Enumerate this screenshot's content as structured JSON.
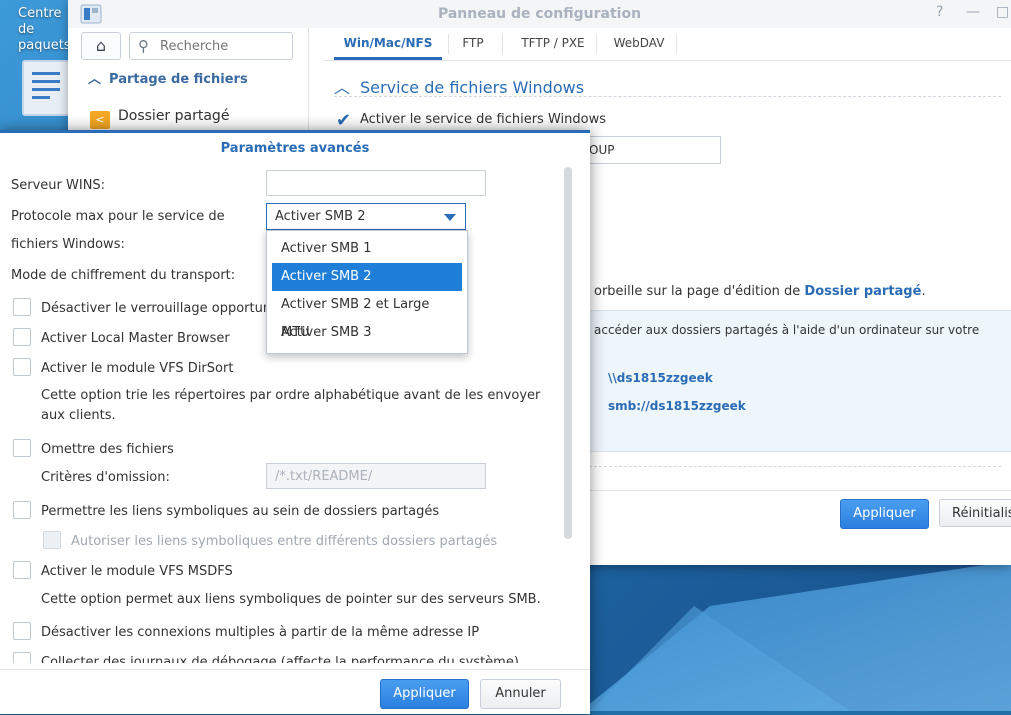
{
  "desktop": {
    "label": "Centre de paquets"
  },
  "control_panel": {
    "title": "Panneau de configuration",
    "controls": {
      "help": "?",
      "minimize": "—",
      "maximize": "□"
    },
    "search_placeholder": "Recherche",
    "sidebar": {
      "section": "Partage de fichiers",
      "items": [
        {
          "label": "Dossier partagé"
        }
      ]
    },
    "tabs": [
      {
        "label": "Win/Mac/NFS",
        "active": true
      },
      {
        "label": "FTP",
        "active": false
      },
      {
        "label": "TFTP / PXE",
        "active": false
      },
      {
        "label": "WebDAV",
        "active": false
      }
    ],
    "section_title": "Service de fichiers Windows",
    "enable_checkbox_label": "Activer le service de fichiers Windows",
    "workgroup_value": "OUP",
    "recycle_text": "orbeille sur la page d'édition de ",
    "recycle_link": "Dossier partagé",
    "recycle_suffix": ".",
    "info_text": "accéder aux dossiers partagés à l'aide d'un ordinateur sur votre",
    "path_unc": "\\\\ds1815zzgeek",
    "path_smb": "smb://ds1815zzgeek",
    "apply_label": "Appliquer",
    "reset_label": "Réinitialis"
  },
  "dialog": {
    "title": "Paramètres avancés",
    "wins_label": "Serveur WINS:",
    "wins_value": "",
    "protocol_label_line1": "Protocole max pour le service de",
    "protocol_label_line2": "fichiers Windows:",
    "protocol_selected": "Activer SMB 2",
    "protocol_options": [
      {
        "label": "Activer SMB 1",
        "selected": false
      },
      {
        "label": "Activer SMB 2",
        "selected": true
      },
      {
        "label": "Activer SMB 2 et Large MTU",
        "selected": false
      },
      {
        "label": "Activer SMB 3",
        "selected": false
      }
    ],
    "encryption_label": "Mode de chiffrement du transport:",
    "options": {
      "oplock": "Désactiver le verrouillage opportuni",
      "local_master": "Activer Local Master Browser",
      "dirsort": "Activer le module VFS DirSort",
      "dirsort_desc": "Cette option trie les répertoires par ordre alphabétique avant de les envoyer aux clients.",
      "veto": "Omettre des fichiers",
      "veto_criteria_label": "Critères d'omission:",
      "veto_criteria_placeholder": "/*.txt/README/",
      "symlinks": "Permettre les liens symboliques au sein de dossiers partagés",
      "symlinks_cross": "Autoriser les liens symboliques entre différents dossiers partagés",
      "msdfs": "Activer le module VFS MSDFS",
      "msdfs_desc": "Cette option permet aux liens symboliques de pointer sur des serveurs SMB.",
      "multi_conn": "Désactiver les connexions multiples à partir de la même adresse IP",
      "debug_logs": "Collecter des journaux de débogage (affecte la performance du système)"
    },
    "apply_label": "Appliquer",
    "cancel_label": "Annuler"
  },
  "colors": {
    "accent": "#2a6cb5",
    "selected_option": "#1e7ed8",
    "primary_button": "#2b7fe0"
  }
}
